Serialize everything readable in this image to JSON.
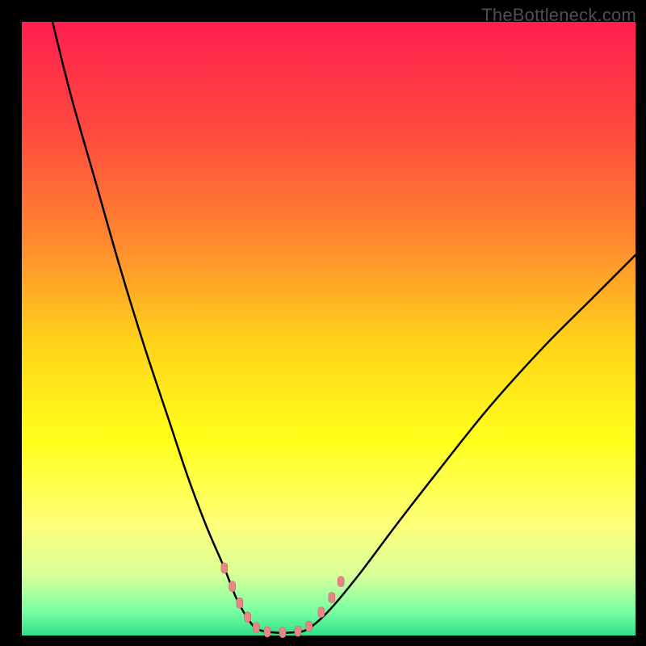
{
  "watermark": "TheBottleneck.com",
  "colors": {
    "background": "#000000",
    "gradient_stops": [
      {
        "offset": 0.0,
        "color": "#ff1f4f"
      },
      {
        "offset": 0.18,
        "color": "#ff4a3f"
      },
      {
        "offset": 0.36,
        "color": "#ff8a2e"
      },
      {
        "offset": 0.52,
        "color": "#ffd21a"
      },
      {
        "offset": 0.68,
        "color": "#ffff1a"
      },
      {
        "offset": 0.82,
        "color": "#fdff7a"
      },
      {
        "offset": 0.9,
        "color": "#d9ff9a"
      },
      {
        "offset": 0.96,
        "color": "#7affa2"
      },
      {
        "offset": 1.0,
        "color": "#2fe08a"
      }
    ],
    "curve": "#000000",
    "marker_fill": "#e38787",
    "marker_stroke": "#d06868"
  },
  "chart_data": {
    "type": "line",
    "title": "",
    "xlabel": "",
    "ylabel": "",
    "xlim": [
      0,
      100
    ],
    "ylim": [
      0,
      100
    ],
    "grid": false,
    "legend": false,
    "series": [
      {
        "name": "left-branch",
        "x": [
          5,
          8,
          12,
          16,
          20,
          24,
          27,
          30,
          33,
          35,
          37,
          38.5
        ],
        "y": [
          100,
          88,
          74,
          60,
          47,
          35,
          26,
          18,
          11,
          6,
          2.5,
          1
        ]
      },
      {
        "name": "valley-floor",
        "x": [
          38.5,
          41,
          44,
          46.5
        ],
        "y": [
          1,
          0.5,
          0.5,
          1
        ]
      },
      {
        "name": "right-branch",
        "x": [
          46.5,
          50,
          55,
          61,
          68,
          76,
          85,
          93,
          100
        ],
        "y": [
          1,
          4,
          10,
          18,
          27,
          37,
          47,
          55,
          62
        ]
      }
    ],
    "markers": {
      "name": "highlight-points",
      "points": [
        {
          "x": 33.0,
          "y": 11.0
        },
        {
          "x": 34.3,
          "y": 8.0
        },
        {
          "x": 35.5,
          "y": 5.3
        },
        {
          "x": 36.8,
          "y": 3.0
        },
        {
          "x": 38.2,
          "y": 1.3
        },
        {
          "x": 40.0,
          "y": 0.6
        },
        {
          "x": 42.5,
          "y": 0.5
        },
        {
          "x": 45.0,
          "y": 0.7
        },
        {
          "x": 46.8,
          "y": 1.5
        },
        {
          "x": 48.8,
          "y": 3.8
        },
        {
          "x": 50.5,
          "y": 6.2
        },
        {
          "x": 52.0,
          "y": 8.8
        }
      ]
    }
  }
}
